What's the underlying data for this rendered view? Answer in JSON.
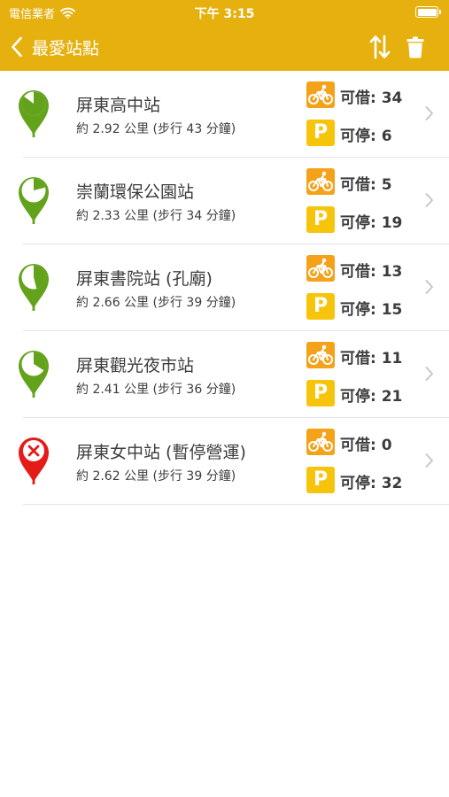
{
  "status_bar": {
    "carrier": "電信業者",
    "time": "下午 3:15"
  },
  "nav": {
    "title": "最愛站點",
    "back_icon": "chevron-left-icon",
    "sort_icon": "swap-vertical-icon",
    "delete_icon": "trash-icon"
  },
  "colors": {
    "header": "#e6b00f",
    "available_pin": "#63a31b",
    "closed_pin": "#e41b17",
    "bike_badge": "#f3a21a",
    "parking_badge": "#f7c40c"
  },
  "stations": [
    {
      "name": "屏東高中站",
      "distance": "約 2.92 公里 (步行 43 分鐘)",
      "rent_label": "可借: 34",
      "return_label": "可停: 6",
      "status": "open",
      "bike_fill_ratio": 0.85
    },
    {
      "name": "崇蘭環保公園站",
      "distance": "約 2.33 公里 (步行 34 分鐘)",
      "rent_label": "可借: 5",
      "return_label": "可停: 19",
      "status": "open",
      "bike_fill_ratio": 0.21
    },
    {
      "name": "屏東書院站 (孔廟)",
      "distance": "約 2.66 公里 (步行 39 分鐘)",
      "rent_label": "可借: 13",
      "return_label": "可停: 15",
      "status": "open",
      "bike_fill_ratio": 0.46
    },
    {
      "name": "屏東觀光夜市站",
      "distance": "約 2.41 公里 (步行 36 分鐘)",
      "rent_label": "可借: 11",
      "return_label": "可停: 21",
      "status": "open",
      "bike_fill_ratio": 0.34
    },
    {
      "name": "屏東女中站 (暫停營運)",
      "distance": "約 2.62 公里 (步行 39 分鐘)",
      "rent_label": "可借: 0",
      "return_label": "可停: 32",
      "status": "closed",
      "bike_fill_ratio": 0
    }
  ]
}
